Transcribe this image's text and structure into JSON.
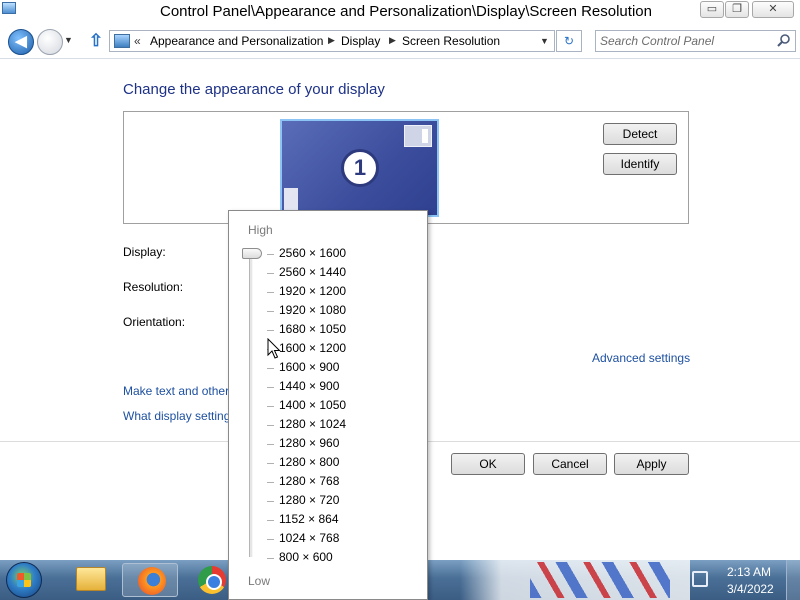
{
  "window": {
    "title": "Control Panel\\Appearance and Personalization\\Display\\Screen Resolution",
    "minimize_glyph": "▭",
    "maximize_glyph": "❐",
    "close_glyph": "✕"
  },
  "nav": {
    "back_glyph": "◀",
    "up_glyph": "⇧",
    "breadcrumb_prefix": "«",
    "breadcrumbs": [
      "Appearance and Personalization",
      "Display",
      "Screen Resolution"
    ],
    "breadcrumb_separator": "▶",
    "refresh_glyph": "↻",
    "search_placeholder": "Search Control Panel"
  },
  "main": {
    "title": "Change the appearance of your display",
    "monitor_number": "1",
    "detect_label": "Detect",
    "identify_label": "Identify",
    "display_label": "Display:",
    "resolution_label": "Resolution:",
    "orientation_label": "Orientation:",
    "advanced_link": "Advanced settings",
    "link_text_size": "Make text and other",
    "link_display_settings": "What display setting"
  },
  "buttons": {
    "ok": "OK",
    "cancel": "Cancel",
    "apply": "Apply"
  },
  "resolution_dropdown": {
    "high_label": "High",
    "low_label": "Low",
    "selected_index": 0,
    "options": [
      "2560 × 1600",
      "2560 × 1440",
      "1920 × 1200",
      "1920 × 1080",
      "1680 × 1050",
      "1600 × 1200",
      "1600 × 900",
      "1440 × 900",
      "1400 × 1050",
      "1280 × 1024",
      "1280 × 960",
      "1280 × 800",
      "1280 × 768",
      "1280 × 720",
      "1152 × 864",
      "1024 × 768",
      "800 × 600"
    ]
  },
  "taskbar": {
    "apps": [
      "windows-explorer",
      "firefox",
      "chrome"
    ],
    "active_app": "firefox",
    "clock_time": "2:13 AM",
    "clock_date": "3/4/2022"
  },
  "colors": {
    "heading": "#1e3287",
    "link": "#1e50a0",
    "monitor_fill": "#3b4d9c",
    "taskbar": "#4a6f96"
  }
}
